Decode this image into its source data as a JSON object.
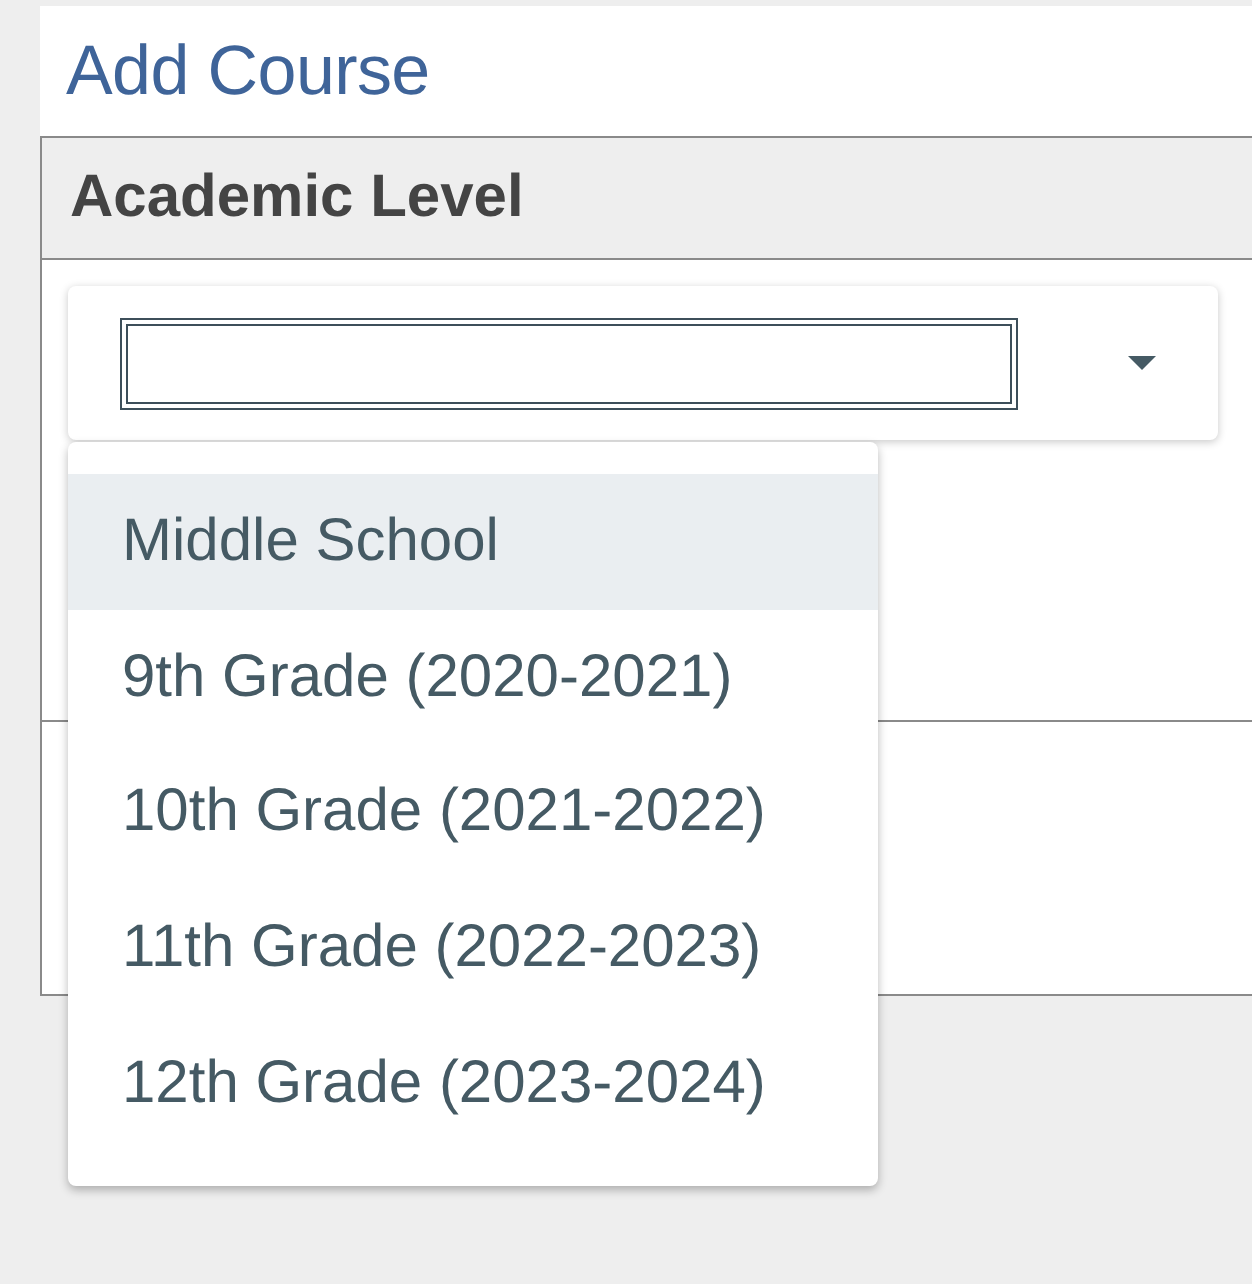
{
  "page": {
    "title": "Add Course"
  },
  "academic_level": {
    "heading": "Academic Level",
    "dropdown": {
      "expanded": true,
      "options": [
        {
          "label": "Middle School",
          "selected": true
        },
        {
          "label": "9th Grade (2020-2021)",
          "selected": false
        },
        {
          "label": "10th Grade (2021-2022)",
          "selected": false
        },
        {
          "label": "11th Grade (2022-2023)",
          "selected": false
        },
        {
          "label": "12th Grade (2023-2024)",
          "selected": false
        }
      ]
    }
  }
}
